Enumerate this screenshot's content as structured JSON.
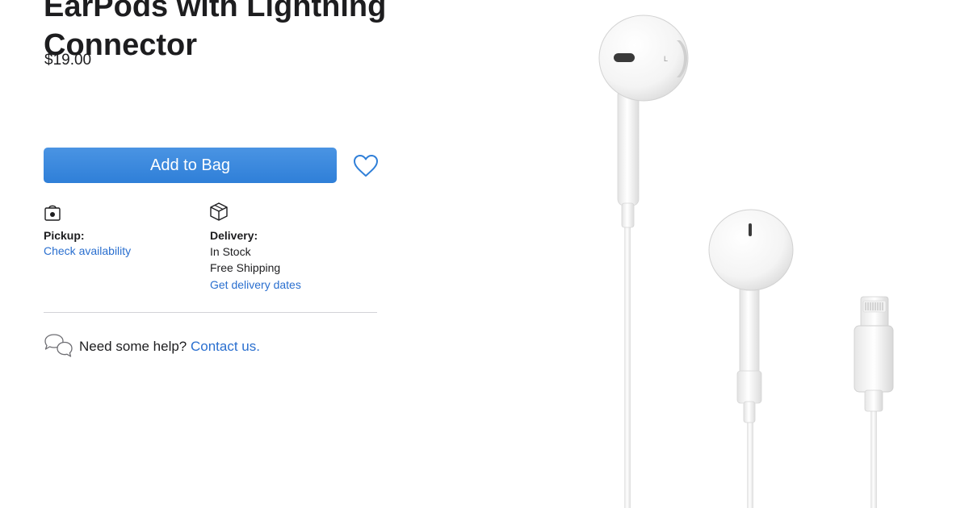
{
  "product": {
    "title_line1": "EarPods with Lightning",
    "title_line2": "Connector",
    "price": "$19.00",
    "image_alt": "EarPods with Lightning Connector"
  },
  "actions": {
    "add_to_bag": "Add to Bag",
    "favorite_icon": "heart-icon"
  },
  "pickup": {
    "icon": "bag-icon",
    "label": "Pickup:",
    "link": "Check availability"
  },
  "delivery": {
    "icon": "box-icon",
    "label": "Delivery:",
    "status": "In Stock",
    "shipping": "Free Shipping",
    "link": "Get delivery dates"
  },
  "help": {
    "icon": "chat-bubbles-icon",
    "text": "Need some help?",
    "link": "Contact us."
  },
  "colors": {
    "accent": "#2f7fd8",
    "link": "#2a6fcf",
    "text": "#1d1d1f",
    "divider": "#d2d2d7"
  }
}
